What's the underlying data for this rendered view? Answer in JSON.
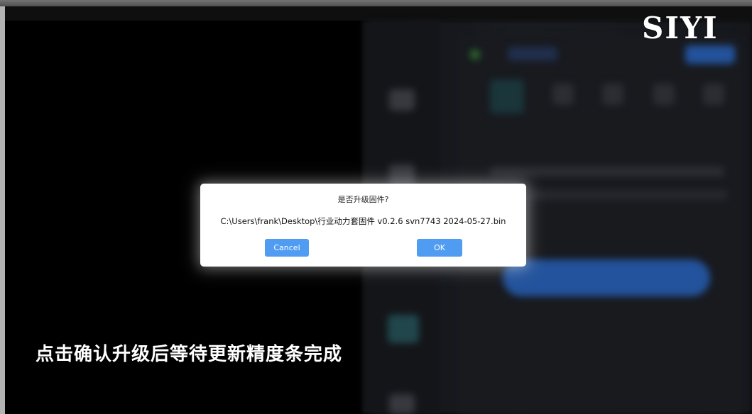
{
  "brand": {
    "logo_text": "SIYI"
  },
  "dialog": {
    "title": "是否升级固件?",
    "file_path": "C:\\Users\\frank\\Desktop\\行业动力套固件 v0.2.6 svn7743 2024-05-27.bin",
    "cancel_label": "Cancel",
    "ok_label": "OK"
  },
  "subtitle": "点击确认升级后等待更新精度条完成",
  "colors": {
    "button_blue": "#4f9cf2",
    "background_panel": "#202329"
  }
}
